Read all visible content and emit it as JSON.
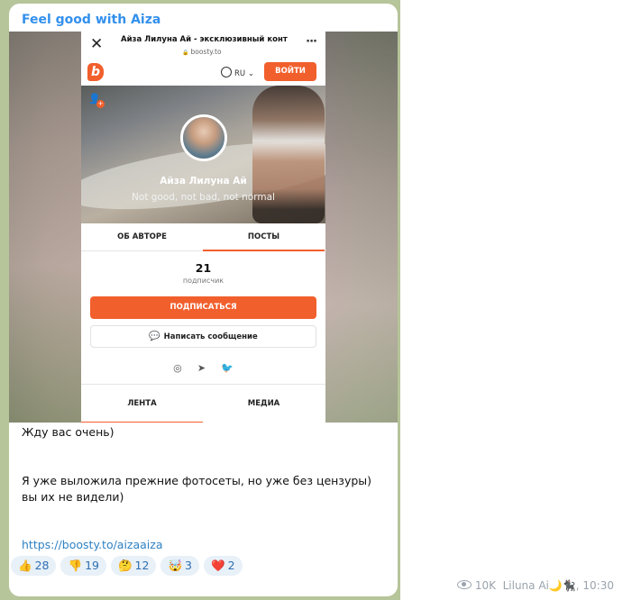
{
  "channel": {
    "name": "Feel good with Aiza"
  },
  "browser": {
    "page_title": "Айза Лилуна Ай - эксклюзивный конте...",
    "url": "boosty.to",
    "close_glyph": "✕",
    "more_glyph": "···",
    "lock_icon": "lock-icon"
  },
  "site": {
    "logo": "b",
    "language": "RU",
    "language_caret": "⌄",
    "login_label": "ВОЙТИ",
    "accent_color": "#f15f2c"
  },
  "profile": {
    "name": "Айза Лилуна Ай",
    "status": "Not good, not bad, not normal",
    "tabs": [
      {
        "label": "ОБ АВТОРЕ",
        "active": false
      },
      {
        "label": "ПОСТЫ",
        "active": true
      }
    ],
    "subscribers_count": "21",
    "subscribers_label": "подписчик",
    "subscribe_label": "ПОДПИСАТЬСЯ",
    "message_label": "Написать сообщение",
    "socials": [
      "instagram-icon",
      "telegram-icon",
      "twitter-icon"
    ],
    "feed_tabs": [
      {
        "label": "ЛЕНТА",
        "active": true
      },
      {
        "label": "МЕДИА",
        "active": false
      }
    ]
  },
  "message": {
    "line1": "Жду вас очень)",
    "line2": "Я уже выложила прежние фотосеты, но уже без цензуры) вы их не видели)",
    "link": "https://boosty.to/aizaaiza"
  },
  "reactions": [
    {
      "emoji": "👍",
      "count": "28"
    },
    {
      "emoji": "👎",
      "count": "19"
    },
    {
      "emoji": "🤔",
      "count": "12"
    },
    {
      "emoji": "🤯",
      "count": "3"
    },
    {
      "emoji": "❤️",
      "count": "2"
    }
  ],
  "meta": {
    "views": "10K",
    "author": "Liluna Ai🌙🐈‍⬛,",
    "time": "10:30"
  }
}
